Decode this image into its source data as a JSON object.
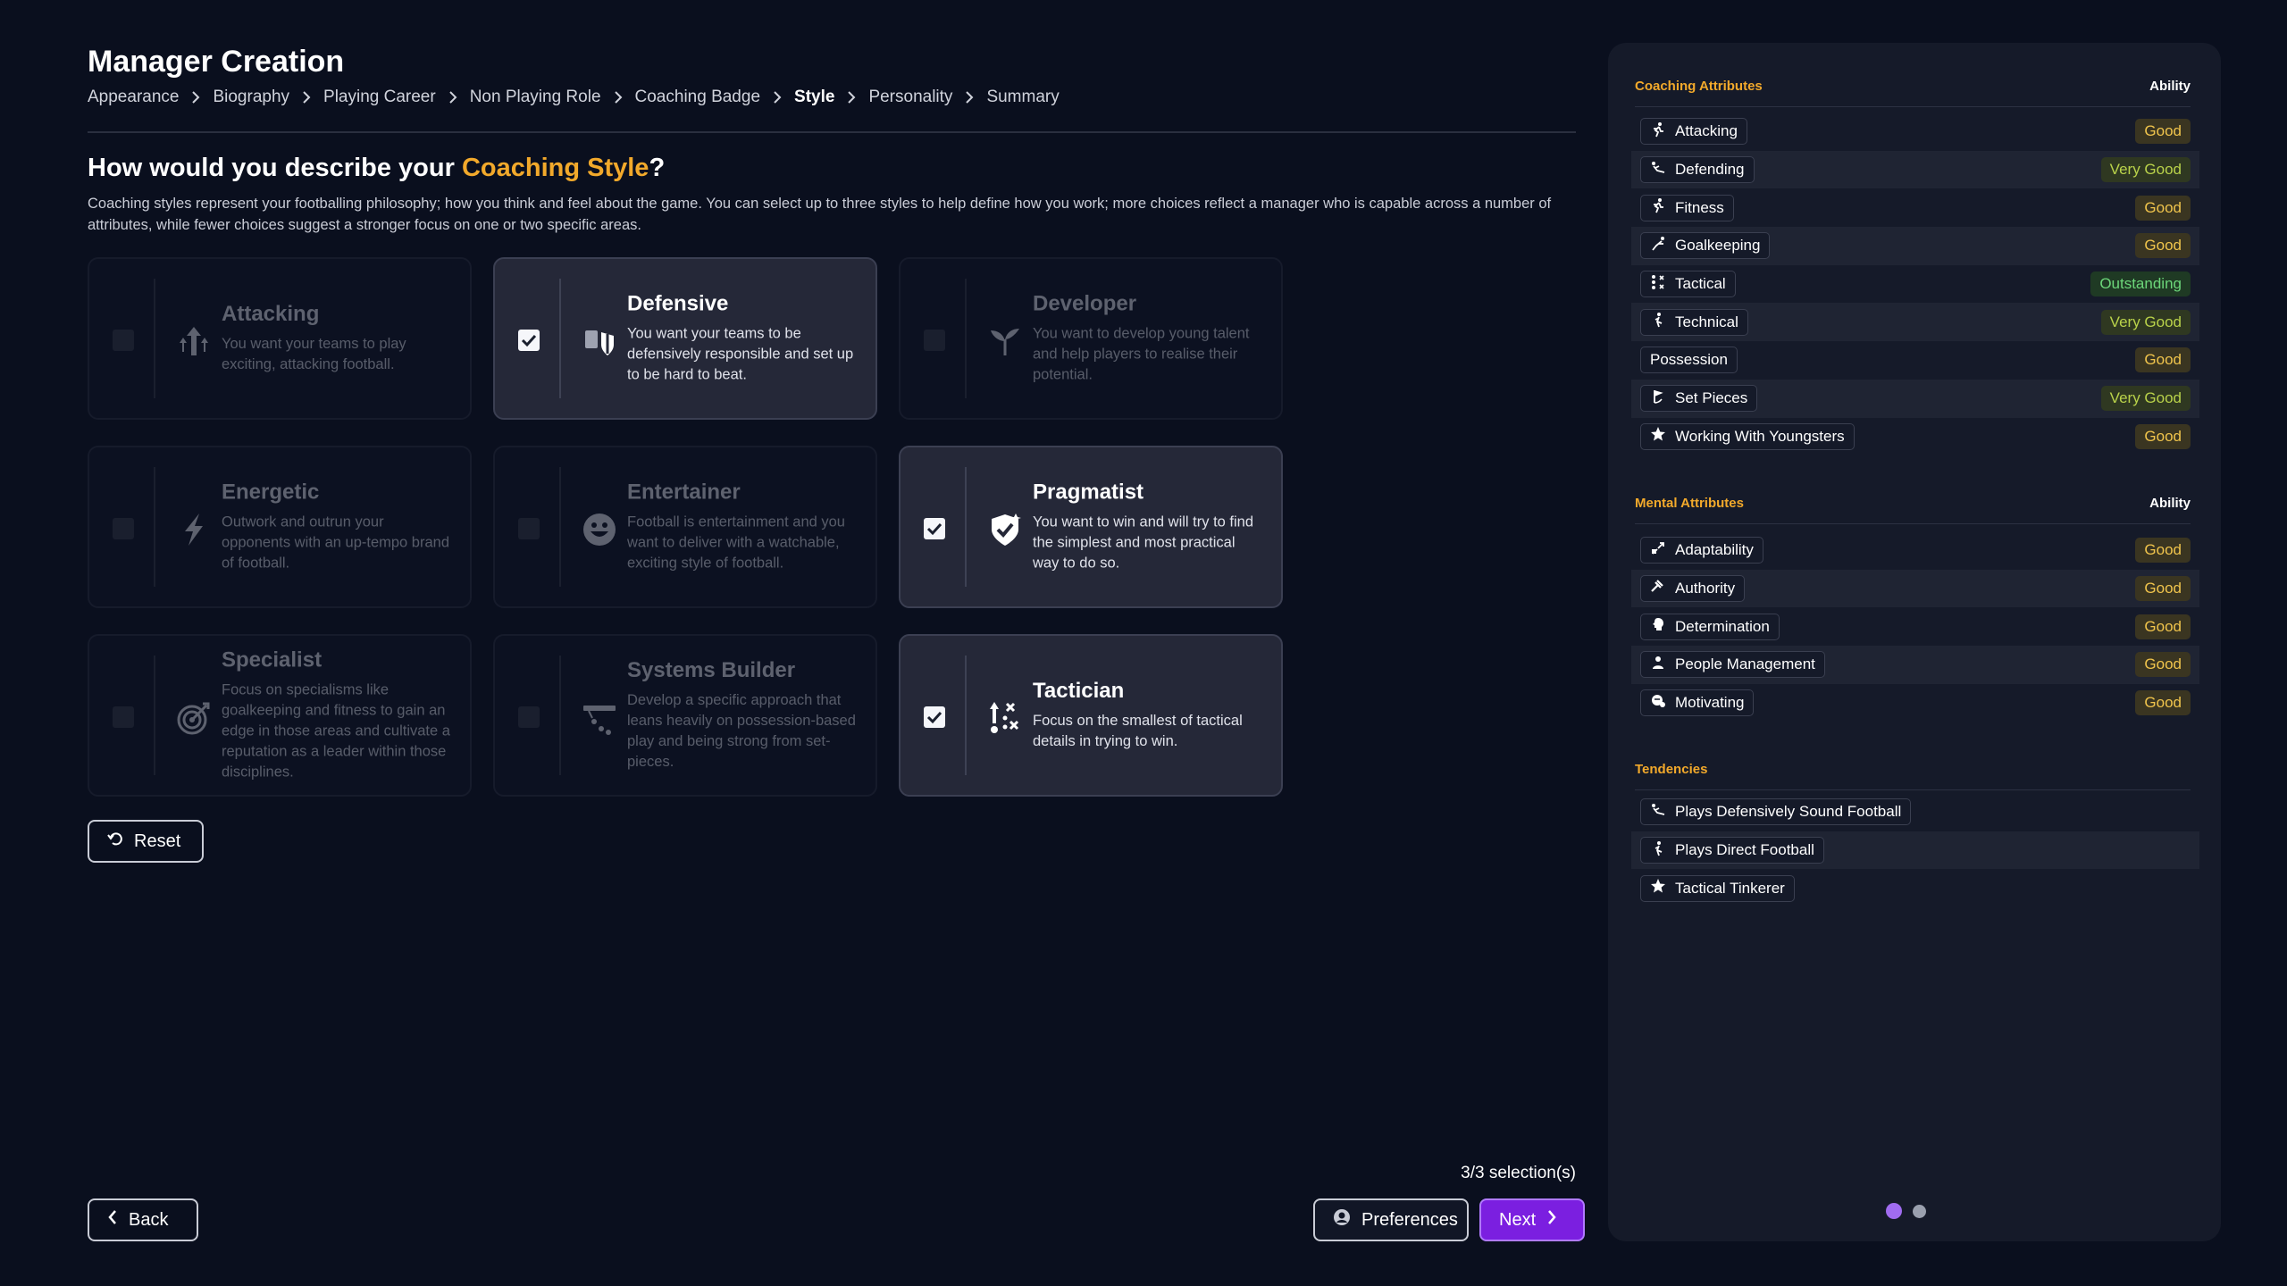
{
  "header": {
    "title": "Manager Creation",
    "breadcrumbs": [
      "Appearance",
      "Biography",
      "Playing Career",
      "Non Playing Role",
      "Coaching Badge",
      "Style",
      "Personality",
      "Summary"
    ],
    "active_crumb": "Style"
  },
  "question": {
    "prefix": "How would you describe your ",
    "highlight": "Coaching Style",
    "suffix": "?"
  },
  "description": "Coaching styles represent your footballing philosophy; how you think and feel about the game. You can select up to three styles to help define how you work; more choices reflect a manager who is capable across a number of attributes, while fewer choices suggest a stronger focus on one or two specific areas.",
  "styles": [
    {
      "title": "Attacking",
      "desc": "You want your teams to play exciting, attacking football.",
      "icon": "upward-arrows-icon",
      "selected": false
    },
    {
      "title": "Defensive",
      "desc": "You want your teams to be defensively responsible and set up to be hard to beat.",
      "icon": "shield-icon",
      "selected": true
    },
    {
      "title": "Developer",
      "desc": "You want to develop young talent and help players to realise their potential.",
      "icon": "sprout-icon",
      "selected": false
    },
    {
      "title": "Energetic",
      "desc": "Outwork and outrun your opponents with an up-tempo brand of football.",
      "icon": "lightning-icon",
      "selected": false
    },
    {
      "title": "Entertainer",
      "desc": "Football is entertainment and you want to deliver with a watchable, exciting style of football.",
      "icon": "smiley-icon",
      "selected": false
    },
    {
      "title": "Pragmatist",
      "desc": "You want to win and will try to find the simplest and most practical way to do so.",
      "icon": "shield-check-icon",
      "selected": true
    },
    {
      "title": "Specialist",
      "desc": "Focus on specialisms like goalkeeping and fitness to gain an edge in those areas and cultivate a reputation as a leader within those disciplines.",
      "icon": "target-icon",
      "selected": false
    },
    {
      "title": "Systems Builder",
      "desc": "Develop a specific approach that leans heavily on possession-based play and being strong from set-pieces.",
      "icon": "system-icon",
      "selected": false
    },
    {
      "title": "Tactician",
      "desc": "Focus on the smallest of tactical details in trying to win.",
      "icon": "tactics-board-icon",
      "selected": true
    }
  ],
  "buttons": {
    "reset": "Reset",
    "back": "Back",
    "preferences": "Preferences",
    "next": "Next"
  },
  "selection_count": "3/3 selection(s)",
  "panel": {
    "coaching": {
      "title": "Coaching Attributes",
      "ability_label": "Ability",
      "rows": [
        {
          "name": "Attacking",
          "value": "Good",
          "icon": "running-icon"
        },
        {
          "name": "Defending",
          "value": "Very Good",
          "icon": "slide-tackle-icon"
        },
        {
          "name": "Fitness",
          "value": "Good",
          "icon": "running-icon"
        },
        {
          "name": "Goalkeeping",
          "value": "Good",
          "icon": "diving-keeper-icon"
        },
        {
          "name": "Tactical",
          "value": "Outstanding",
          "icon": "tactics-icon"
        },
        {
          "name": "Technical",
          "value": "Very Good",
          "icon": "kicking-icon"
        },
        {
          "name": "Possession",
          "value": "Good",
          "icon": ""
        },
        {
          "name": "Set Pieces",
          "value": "Very Good",
          "icon": "corner-flag-icon"
        },
        {
          "name": "Working With Youngsters",
          "value": "Good",
          "icon": "star-icon"
        }
      ]
    },
    "mental": {
      "title": "Mental Attributes",
      "ability_label": "Ability",
      "rows": [
        {
          "name": "Adaptability",
          "value": "Good",
          "icon": "adapt-icon"
        },
        {
          "name": "Authority",
          "value": "Good",
          "icon": "gavel-icon"
        },
        {
          "name": "Determination",
          "value": "Good",
          "icon": "head-icon"
        },
        {
          "name": "People Management",
          "value": "Good",
          "icon": "people-icon"
        },
        {
          "name": "Motivating",
          "value": "Good",
          "icon": "cheering-icon"
        }
      ]
    },
    "tendencies": {
      "title": "Tendencies",
      "rows": [
        {
          "name": "Plays Defensively Sound Football",
          "icon": "slide-tackle-icon"
        },
        {
          "name": "Plays Direct Football",
          "icon": "kicking-icon"
        },
        {
          "name": "Tactical Tinkerer",
          "icon": "star-icon"
        }
      ]
    },
    "pager": {
      "pages": 2,
      "current": 1
    }
  }
}
